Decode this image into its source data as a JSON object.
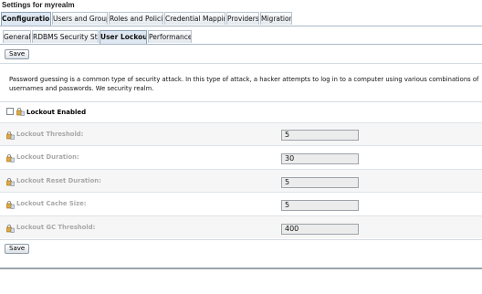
{
  "window": {
    "title": "Settings for myrealm"
  },
  "tabs_primary": [
    {
      "label": "Configuration",
      "active": true
    },
    {
      "label": "Users and Groups",
      "active": false
    },
    {
      "label": "Roles and Policies",
      "active": false
    },
    {
      "label": "Credential Mappings",
      "active": false
    },
    {
      "label": "Providers",
      "active": false
    },
    {
      "label": "Migration",
      "active": false
    }
  ],
  "tabs_secondary": [
    {
      "label": "General",
      "active": false
    },
    {
      "label": "RDBMS Security Store",
      "active": false
    },
    {
      "label": "User Lockout",
      "active": true
    },
    {
      "label": "Performance",
      "active": false
    }
  ],
  "toolbar": {
    "save_label": "Save"
  },
  "description": "Password guessing is a common type of security attack. In this type of attack, a hacker attempts to log in to a computer using various combinations of usernames and passwords. We security realm.",
  "lockout_enabled": {
    "label": "Lockout Enabled",
    "checked": false
  },
  "fields": [
    {
      "label": "Lockout Threshold:",
      "value": "5"
    },
    {
      "label": "Lockout Duration:",
      "value": "30"
    },
    {
      "label": "Lockout Reset Duration:",
      "value": "5"
    },
    {
      "label": "Lockout Cache Size:",
      "value": "5"
    },
    {
      "label": "Lockout GC Threshold:",
      "value": "400"
    }
  ],
  "footer": {
    "save_label": "Save"
  },
  "icons": {
    "field_icon": "policy-lock-icon"
  },
  "colors": {
    "active_tab": "#dfe8f2",
    "disabled_label": "#a8a8a8",
    "field_bg": "#ececec"
  }
}
